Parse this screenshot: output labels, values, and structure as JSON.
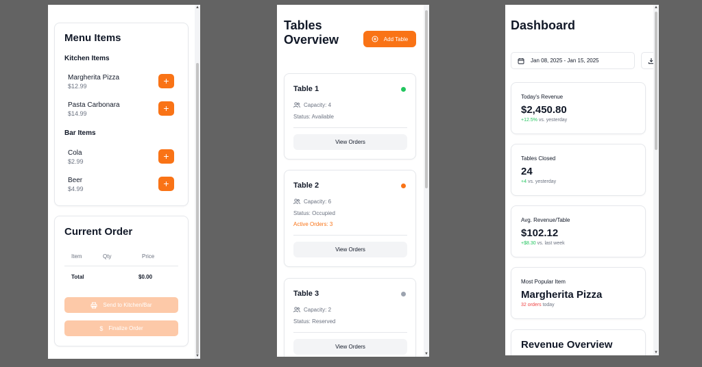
{
  "colors": {
    "accent": "#f97316",
    "accent_disabled": "#fdc9a8",
    "success": "#22c55e",
    "neutral_dot": "#9ca3af",
    "danger": "#ef4444"
  },
  "menu": {
    "title": "Menu Items",
    "kitchen_heading": "Kitchen Items",
    "kitchen_items": [
      {
        "name": "Margherita Pizza",
        "price": "$12.99",
        "button": "+"
      },
      {
        "name": "Pasta Carbonara",
        "price": "$14.99",
        "button": "+"
      }
    ],
    "bar_heading": "Bar Items",
    "bar_items": [
      {
        "name": "Cola",
        "price": "$2.99",
        "button": "+"
      },
      {
        "name": "Beer",
        "price": "$4.99",
        "button": "+"
      }
    ]
  },
  "order": {
    "title": "Current Order",
    "columns": [
      "Item",
      "Qty",
      "Price"
    ],
    "total_label": "Total",
    "total_value": "$0.00",
    "send_label": "Send to Kitchen/Bar",
    "finalize_label": "Finalize Order",
    "send_icon": "printer-icon",
    "finalize_icon": "dollar-icon"
  },
  "tables": {
    "title_line1": "Tables",
    "title_line2": "Overview",
    "add_label": "Add Table",
    "add_icon": "plus-circle-icon",
    "items": [
      {
        "name": "Table 1",
        "capacity": "Capacity: 4",
        "status": "Status: Available",
        "status_color": "#22c55e",
        "active_orders": "",
        "button": "View Orders"
      },
      {
        "name": "Table 2",
        "capacity": "Capacity: 6",
        "status": "Status: Occupied",
        "status_color": "#f97316",
        "active_orders": "Active Orders: 3",
        "button": "View Orders"
      },
      {
        "name": "Table 3",
        "capacity": "Capacity: 2",
        "status": "Status: Reserved",
        "status_color": "#9ca3af",
        "active_orders": "",
        "button": "View Orders"
      }
    ]
  },
  "dashboard": {
    "title": "Dashboard",
    "date_range": "Jan 08, 2025 - Jan 15, 2025",
    "date_icon": "calendar-icon",
    "download_icon": "download-icon",
    "stats": [
      {
        "label": "Today's Revenue",
        "value": "$2,450.80",
        "delta": "+12.5%",
        "note": "vs. yesterday"
      },
      {
        "label": "Tables Closed",
        "value": "24",
        "delta": "+4",
        "note": "vs. yesterday"
      },
      {
        "label": "Avg. Revenue/Table",
        "value": "$102.12",
        "delta": "+$8.30",
        "note": "vs. last week"
      },
      {
        "label": "Most Popular Item",
        "value": "Margherita Pizza",
        "delta": "32 orders",
        "note": "today"
      }
    ],
    "revenue_title": "Revenue Overview"
  }
}
